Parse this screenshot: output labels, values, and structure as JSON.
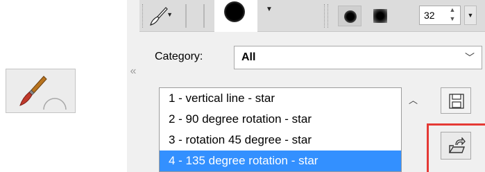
{
  "panel": {
    "toolbar": {
      "brush_size": "32"
    },
    "category": {
      "label": "Category:",
      "selected": "All"
    },
    "presets": [
      "1 - vertical line - star",
      "2 - 90 degree rotation - star",
      "3 - rotation 45 degree - star",
      "4 - 135 degree rotation - star"
    ],
    "selected_index": 3
  },
  "icons": {
    "left_tool": "paintbrush-icon",
    "save": "floppy-disk-icon",
    "load": "load-preset-icon"
  },
  "colors": {
    "selection": "#3390ff",
    "highlight": "#e53935"
  }
}
